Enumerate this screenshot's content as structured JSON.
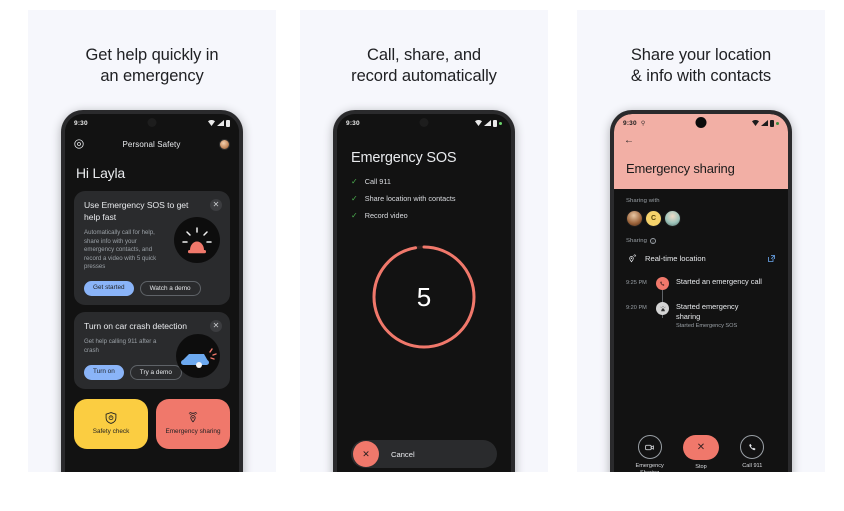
{
  "panels": [
    {
      "title": "Get help quickly in\nan emergency",
      "phone": {
        "status": {
          "time": "9:30"
        },
        "appbar": {
          "title": "Personal Safety",
          "settings_icon": "gear-icon",
          "avatar": "profile-avatar"
        },
        "greeting": "Hi Layla",
        "cards": [
          {
            "heading": "Use Emergency SOS to get help fast",
            "body": "Automatically call for help, share info with your emergency contacts, and record a video with 5 quick presses",
            "close": "✕",
            "art": "siren-icon",
            "chips": [
              {
                "label": "Get started",
                "style": "filled"
              },
              {
                "label": "Watch a demo",
                "style": "outline"
              }
            ]
          },
          {
            "heading": "Turn on car crash detection",
            "body": "Get help calling 911 after a crash",
            "close": "✕",
            "art": "car-crash-icon",
            "chips": [
              {
                "label": "Turn on",
                "style": "filled"
              },
              {
                "label": "Try a demo",
                "style": "outline"
              }
            ]
          }
        ],
        "big_buttons": [
          {
            "label": "Safety check",
            "icon": "clock-shield-icon",
            "color": "#FBCD41"
          },
          {
            "label": "Emergency sharing",
            "icon": "location-broadcast-icon",
            "color": "#F0786B"
          }
        ]
      }
    },
    {
      "title": "Call, share, and\nrecord automatically",
      "phone": {
        "status": {
          "time": "9:30"
        },
        "title": "Emergency SOS",
        "checklist": [
          {
            "tick": "✓",
            "label": "Call 911"
          },
          {
            "tick": "✓",
            "label": "Share location with contacts"
          },
          {
            "tick": "✓",
            "label": "Record video"
          }
        ],
        "countdown": {
          "value": "5",
          "ring_color": "#F0786B",
          "progress_pct": 97
        },
        "cancel": {
          "label": "Cancel",
          "icon": "✕"
        }
      }
    },
    {
      "title": "Share your location\n& info with contacts",
      "phone": {
        "status": {
          "time": "9:30"
        },
        "header": {
          "back_icon": "back-arrow-icon",
          "title": "Emergency sharing",
          "bg": "#F2AFA5"
        },
        "sharing_with_label": "Sharing with",
        "avatars": [
          {
            "type": "photo"
          },
          {
            "type": "initial",
            "initial": "C"
          },
          {
            "type": "photo"
          }
        ],
        "sharing_label": "Sharing",
        "sharing_row": {
          "icon": "location-broadcast-icon",
          "label": "Real-time location",
          "action_icon": "open-external-icon"
        },
        "timeline": [
          {
            "time": "9:25 PM",
            "dot": "red",
            "icon": "call-icon",
            "title": "Started an emergency call",
            "sub": ""
          },
          {
            "time": "9:20 PM",
            "dot": "grey",
            "icon": "siren-icon",
            "title": "Started emergency sharing",
            "sub": "Started Emergency SOS"
          }
        ],
        "actions": [
          {
            "label": "Emergency\nSharing",
            "icon": "video-camera-icon",
            "style": "outline"
          },
          {
            "label": "Stop",
            "icon": "✕",
            "style": "stop"
          },
          {
            "label": "Call 911",
            "icon": "phone-icon",
            "style": "outline"
          }
        ]
      }
    }
  ],
  "colors": {
    "panel_bg": "#F6F7FC",
    "accent_blue": "#8AB4F8",
    "accent_red": "#F0786B",
    "accent_yellow": "#FBCD41",
    "header_pink": "#F2AFA5"
  }
}
